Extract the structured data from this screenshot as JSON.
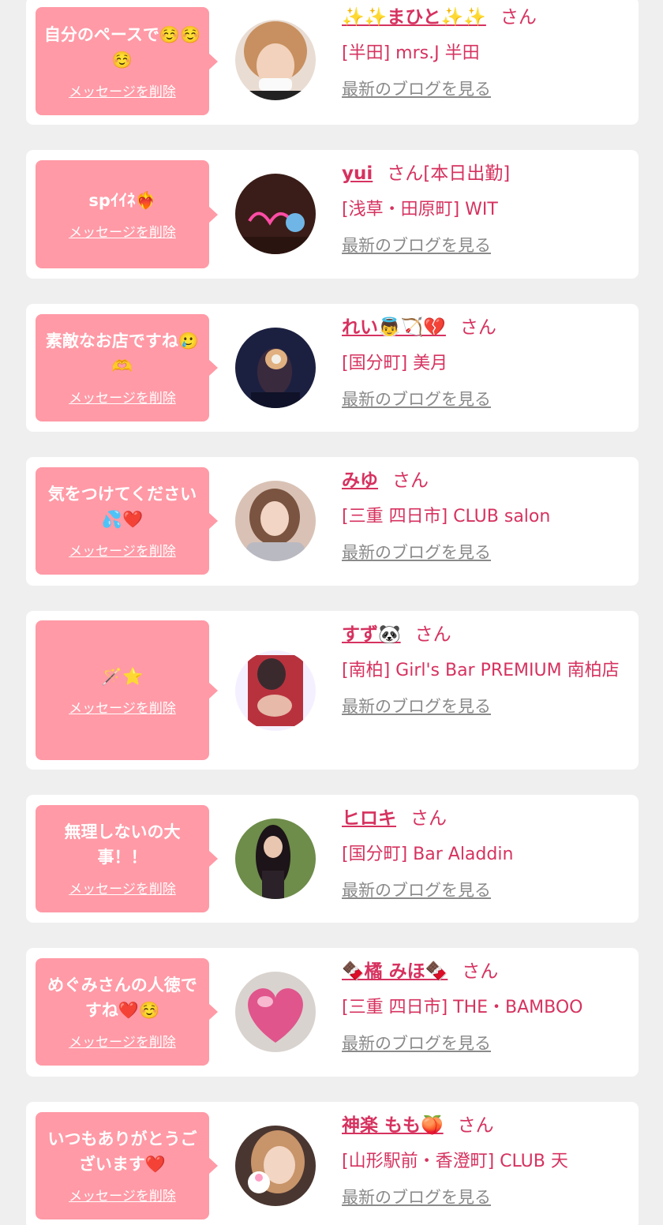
{
  "entries": [
    {
      "message": "自分のペースで☺️☺️☺️",
      "delete_label": "メッセージを削除",
      "name": "✨✨まひと✨✨",
      "suffix": "さん",
      "shop": "[半田] mrs.J 半田",
      "blog_label": "最新のブログを見る",
      "avatar_colors": [
        "#3a2a22",
        "#e8c7a8",
        "#c89060"
      ]
    },
    {
      "message": "spｲｲﾈ❤️‍🔥",
      "delete_label": "メッセージを削除",
      "name": "yui",
      "suffix": "さん[本日出勤]",
      "shop": "[浅草・田原町] WIT",
      "blog_label": "最新のブログを見る",
      "avatar_colors": [
        "#3a1d18",
        "#ff4da6",
        "#6fb6e6"
      ]
    },
    {
      "message": "素敵なお店ですね🥲🫶",
      "delete_label": "メッセージを削除",
      "name": "れい👼🏹💔",
      "suffix": "さん",
      "shop": "[国分町] 美月",
      "blog_label": "最新のブログを見る",
      "avatar_colors": [
        "#1c2040",
        "#e0b080",
        "#f2efe8"
      ]
    },
    {
      "message": "気をつけてください💦❤️",
      "delete_label": "メッセージを削除",
      "name": "みゆ",
      "suffix": "さん",
      "shop": "[三重 四日市] CLUB salon",
      "blog_label": "最新のブログを見る",
      "avatar_colors": [
        "#d9c2b5",
        "#7a5440",
        "#b9b9c2"
      ]
    },
    {
      "message": "🪄⭐",
      "delete_label": "メッセージを削除",
      "name": "すず🐼",
      "suffix": "さん",
      "shop": "[南柏] Girl's Bar PREMIUM 南柏店",
      "blog_label": "最新のブログを見る",
      "avatar_colors": [
        "#f5f0ff",
        "#b8323e",
        "#3a2a2e"
      ]
    },
    {
      "message": "無理しないの大事！！",
      "delete_label": "メッセージを削除",
      "name": "ヒロキ",
      "suffix": "さん",
      "shop": "[国分町] Bar Aladdin",
      "blog_label": "最新のブログを見る",
      "avatar_colors": [
        "#6e8c4a",
        "#1c1418",
        "#e9c6b0"
      ]
    },
    {
      "message": "めぐみさんの人徳ですね❤️☺️",
      "delete_label": "メッセージを削除",
      "name": "🍫橘 みほ🍫",
      "suffix": "さん",
      "shop": "[三重 四日市] THE・BAMBOO",
      "blog_label": "最新のブログを見る",
      "avatar_colors": [
        "#d9d3cf",
        "#e0558c",
        "#f7b8d0"
      ]
    },
    {
      "message": "いつもありがとうございます❤️",
      "delete_label": "メッセージを削除",
      "name": "神楽 もも🍑",
      "suffix": "さん",
      "shop": "[山形駅前・香澄町] CLUB 天",
      "blog_label": "最新のブログを見る",
      "avatar_colors": [
        "#4a3630",
        "#f2d5c2",
        "#ff9ec4"
      ]
    }
  ]
}
